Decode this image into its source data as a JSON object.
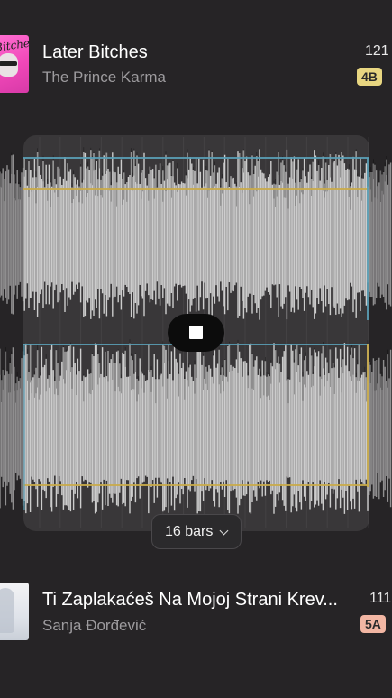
{
  "tracks": [
    {
      "title": "Later Bitches",
      "artist": "The Prince Karma",
      "bpm": "121",
      "key": "4B",
      "art_text": "Bitches",
      "key_color": "#e8d681"
    },
    {
      "title": "Ti Zaplakaćeš Na Mojoj Strani Krev...",
      "artist": "Sanja Đorđević",
      "bpm": "111",
      "key": "5A",
      "key_color": "#f2b6a3"
    }
  ],
  "player": {
    "stop_icon": "stop-icon"
  },
  "loop": {
    "length_label": "16 bars",
    "dropdown_icon": "chevron-down-icon"
  },
  "colors": {
    "background": "#262426",
    "waveform": "#e6e6e6",
    "loop_marker_blue": "#5a9fb6",
    "loop_marker_yellow": "#c9ab4a"
  }
}
